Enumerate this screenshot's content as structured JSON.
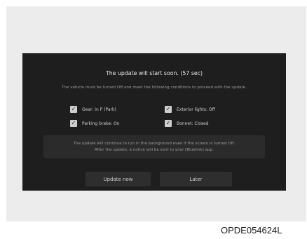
{
  "dialog": {
    "title": "The update will start soon. (57 sec)",
    "subtitle": "The vehicle must be turned Off and meet the following conditions to proceed with the update.",
    "conditions": [
      {
        "label": "Gear: in P (Park)",
        "checked": true
      },
      {
        "label": "Exterior lights: Off",
        "checked": true
      },
      {
        "label": "Parking brake: On",
        "checked": true
      },
      {
        "label": "Bonnet: Closed",
        "checked": true
      }
    ],
    "checkmark": "✓",
    "notice_line1": "The update will continue to run in the background even if the screen is turned Off.",
    "notice_line2": "After the update, a notice will be sent to your [Bluelink] app.",
    "update_now_label": "Update now",
    "later_label": "Later"
  },
  "figure_code": "OPDE054624L",
  "colors": {
    "screen_bg": "#1e1e1e",
    "button_bg": "#2e2e2e",
    "bezel_bg": "#ececec"
  }
}
